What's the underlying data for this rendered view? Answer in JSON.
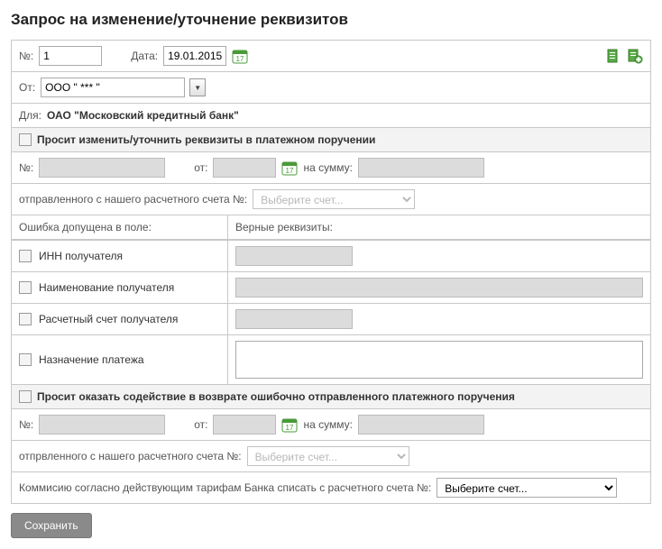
{
  "title": "Запрос на изменение/уточнение реквизитов",
  "header": {
    "num_label": "№:",
    "num_value": "1",
    "date_label": "Дата:",
    "date_value": "19.01.2015"
  },
  "from": {
    "label": "От:",
    "value": "ООО \" *** \""
  },
  "to": {
    "label": "Для:",
    "value": "ОАО \"Московский кредитный банк\""
  },
  "section1": {
    "title": "Просит изменить/уточнить реквизиты в платежном поручении",
    "num_label": "№:",
    "num_value": "",
    "date_label": "от:",
    "date_value": "",
    "sum_label": "на сумму:",
    "sum_value": "",
    "account_label": "отправленного с нашего расчетного счета №:",
    "account_placeholder": "Выберите счет..."
  },
  "grid": {
    "col1_header": "Ошибка допущена в поле:",
    "col2_header": "Верные реквизиты:",
    "rows": [
      {
        "label": "ИНН получателя"
      },
      {
        "label": "Наименование получателя"
      },
      {
        "label": "Расчетный счет получателя"
      },
      {
        "label": "Назначение платежа"
      }
    ]
  },
  "section2": {
    "title": "Просит оказать содействие в возврате ошибочно отправленного платежного поручения",
    "num_label": "№:",
    "num_value": "",
    "date_label": "от:",
    "date_value": "",
    "sum_label": "на сумму:",
    "sum_value": "",
    "account_label": "отпрвленного с нашего расчетного счета №:",
    "account_placeholder": "Выберите счет..."
  },
  "commission": {
    "label": "Коммисию согласно действующим тарифам Банка списать с расчетного счета №:",
    "placeholder": "Выберите счет..."
  },
  "save_label": "Сохранить"
}
